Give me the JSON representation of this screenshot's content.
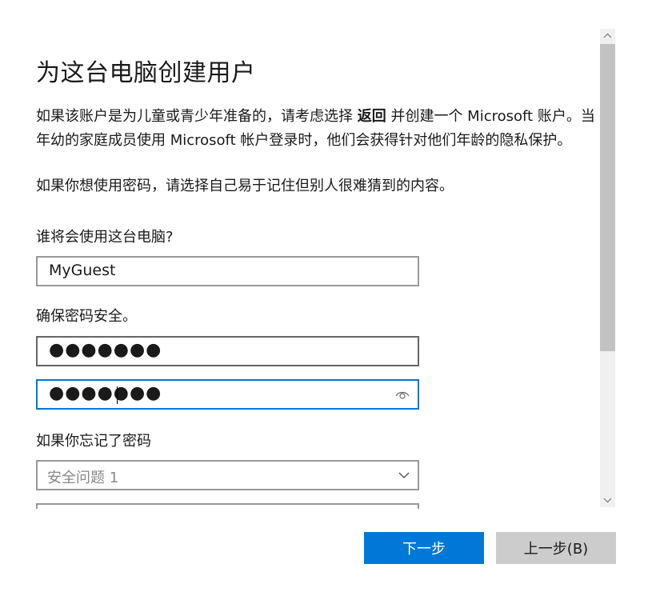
{
  "dialog": {
    "title": "为这台电脑创建用户",
    "intro_part1": "如果该账户是为儿童或青少年准备的，请考虑选择 ",
    "intro_bold": "返回",
    "intro_part2": " 并创建一个 Microsoft 账户。当",
    "intro_line2": "年幼的家庭成员使用 Microsoft 帐户登录时，他们会获得针对他们年龄的隐私保护。",
    "password_hint": "如果你想使用密码，请选择自己易于记住但别人很难猜到的内容。",
    "who_label": "谁将会使用这台电脑?",
    "username_value": "MyGuest",
    "secure_label": "确保密码安全。",
    "password_value": "●●●●●●●",
    "confirm_value": "●●●●●●●",
    "forgot_label": "如果你忘记了密码",
    "security_question_value": "安全问题 1"
  },
  "buttons": {
    "next": "下一步",
    "back": "上一步(B)"
  },
  "icons": {
    "reveal": "eye-icon",
    "dropdown": "chevron-down-icon",
    "scroll_up": "chevron-up-icon",
    "scroll_down": "chevron-down-icon"
  },
  "colors": {
    "accent": "#0078d7",
    "back_button": "#cccccc",
    "border": "#999999"
  }
}
